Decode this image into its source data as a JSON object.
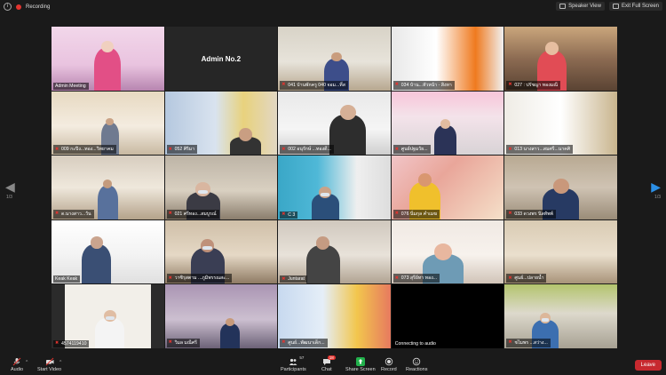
{
  "topbar": {
    "recording_label": "Recording",
    "speaker_view_label": "Speaker View",
    "exit_fullscreen_label": "Exit Full Screen"
  },
  "pager": {
    "left": "1/3",
    "right": "1/3"
  },
  "tiles": [
    {
      "label": "Admin Meeting",
      "muted": false
    },
    {
      "label": "",
      "center": "Admin No.2",
      "muted": false
    },
    {
      "label": "041 บ้านพักครู 040 จอม...ที่ส",
      "muted": true
    },
    {
      "label": "034 บ้าน...หัวหน้า - สิงหา",
      "muted": true
    },
    {
      "label": "027 : ปรัชญา ทองมณี",
      "muted": true
    },
    {
      "label": "009 กะปิง...ทอง...วิทยาคม",
      "muted": true
    },
    {
      "label": "052 ศิริมา",
      "muted": true
    },
    {
      "label": "002 อนุรักษ์ ...ทองดี...",
      "muted": true
    },
    {
      "label": "ศูนย์ปฐมวัย...",
      "muted": true
    },
    {
      "label": "013 นางสาว...สมศรี...นาคศิ",
      "muted": true
    },
    {
      "label": "ด.นางสาว...วัน",
      "muted": true
    },
    {
      "label": "021 ศรีทอง...สมบูรณ์",
      "muted": true
    },
    {
      "label": "C 3",
      "muted": true
    },
    {
      "label": "076 นิ่มกุล คำเมฆ",
      "muted": true
    },
    {
      "label": "033 ดวงพร นิลทัพพ์",
      "muted": true
    },
    {
      "label": "Keak Keak",
      "muted": false
    },
    {
      "label": "วาซิรุสตาม ...ภูมิพรรณสะ...",
      "muted": true
    },
    {
      "label": "Juntarat",
      "muted": true
    },
    {
      "label": "073 สุรีย์ทา ทอง...",
      "muted": true
    },
    {
      "label": "ศูนย์...ปลายน้ำ",
      "muted": true
    },
    {
      "label": "4574119410",
      "muted": true
    },
    {
      "label": "วิมล มณีศรี",
      "muted": true
    },
    {
      "label": "ศูนย์...พัฒนาเด็ก...",
      "muted": true
    },
    {
      "label": "Connecting to audio",
      "muted": false
    },
    {
      "label": "ชไมพร ...สว่าง...",
      "muted": true
    }
  ],
  "toolbar": {
    "audio": "Audio",
    "video": "Start Video",
    "participants": "Participants",
    "participants_count": "57",
    "chat": "Chat",
    "chat_badge": "18",
    "share": "Share Screen",
    "record": "Record",
    "reactions": "Reactions",
    "leave": "Leave"
  },
  "colors": {
    "accent_green": "#22b14c",
    "leave_red": "#c7292f",
    "active_speaker": "#c6d72a",
    "nav_blue": "#2b8fe6"
  }
}
